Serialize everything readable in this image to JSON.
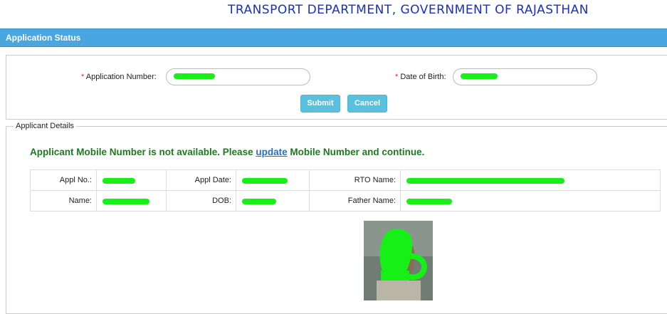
{
  "header": {
    "title": "TRANSPORT DEPARTMENT, GOVERNMENT OF RAJASTHAN"
  },
  "status_bar": {
    "title": "Application Status"
  },
  "form": {
    "application_number_label": "Application Number:",
    "dob_label": "Date of Birth:",
    "required_marker": "*",
    "submit_label": "Submit",
    "cancel_label": "Cancel"
  },
  "details": {
    "legend": "Applicant Details",
    "notice_before": "Applicant Mobile Number is not available. Please ",
    "notice_link": "update",
    "notice_after": " Mobile Number and continue.",
    "labels": {
      "appl_no": "Appl No.:",
      "appl_date": "Appl Date:",
      "rto_name": "RTO Name:",
      "name": "Name:",
      "dob": "DOB:",
      "father_name": "Father Name:"
    }
  },
  "colors": {
    "accent": "#4aa6e0",
    "button": "#5bc0de",
    "notice": "#1e7a1e",
    "mask": "#16f016"
  }
}
